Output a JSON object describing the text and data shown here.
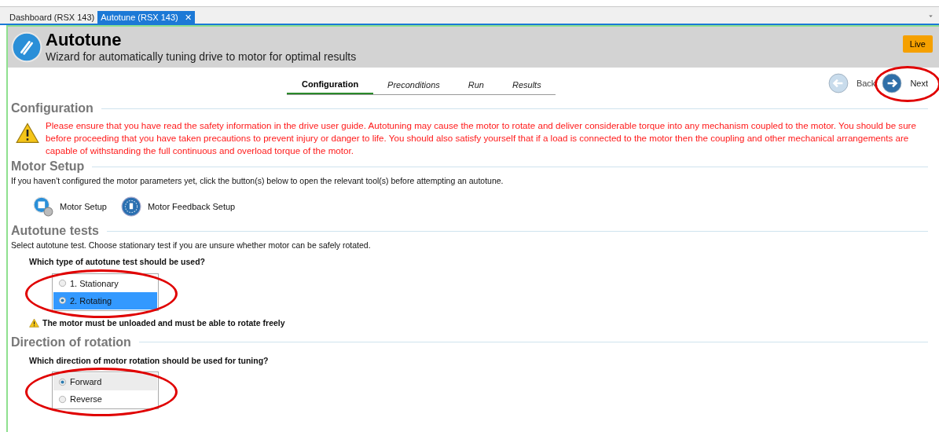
{
  "doc_tabs": [
    {
      "label": "Dashboard (RSX 143)",
      "selected": false,
      "closable": false
    },
    {
      "label": "Autotune (RSX 143)",
      "selected": true,
      "closable": true
    }
  ],
  "close_glyph": "✕",
  "header": {
    "title": "Autotune",
    "subtitle": "Wizard for automatically tuning drive to motor for optimal results",
    "badge": "Live"
  },
  "wizard_steps": [
    {
      "label": "Configuration",
      "selected": true
    },
    {
      "label": "Preconditions",
      "selected": false
    },
    {
      "label": "Run",
      "selected": false
    },
    {
      "label": "Results",
      "selected": false
    }
  ],
  "nav": [
    {
      "kind": "back",
      "label": "Back",
      "disabled": true,
      "circled": false
    },
    {
      "kind": "next",
      "label": "Next",
      "disabled": false,
      "circled": true
    }
  ],
  "sections": [
    {
      "kind": "warning",
      "title": "Configuration",
      "text": "Please ensure that you have read the safety information in the drive user guide. Autotuning may cause the motor to rotate and deliver considerable torque into any mechanism coupled to the motor. You should be sure before proceeding that you have taken precautions to prevent injury or danger to life. You should also satisfy yourself that if a load is connected to the motor then the coupling and other mechanical arrangements are capable of withstanding the full continuous and overload torque of the motor."
    },
    {
      "kind": "tools",
      "title": "Motor Setup",
      "text": "If you haven't configured the motor parameters yet, click the button(s) below to open the relevant tool(s) before attempting an autotune.",
      "tools": [
        {
          "kind": "setup",
          "label": "Motor Setup"
        },
        {
          "kind": "feedback",
          "label": "Motor Feedback Setup"
        }
      ]
    },
    {
      "kind": "choice",
      "title": "Autotune tests",
      "text": "Select autotune test. Choose stationary test if you are unsure whether motor can be safely rotated.",
      "question": "Which type of autotune test should be used?",
      "circled": true,
      "focused": true,
      "options": [
        {
          "label": "1. Stationary",
          "selected": false
        },
        {
          "label": "2. Rotating",
          "selected": true
        }
      ],
      "note": "The motor must be unloaded and must be able to rotate freely"
    },
    {
      "kind": "choice",
      "title": "Direction of rotation",
      "question": "Which direction of motor rotation should be used for tuning?",
      "circled": true,
      "focused": false,
      "options": [
        {
          "label": "Forward",
          "selected": true
        },
        {
          "label": "Reverse",
          "selected": false
        }
      ]
    }
  ]
}
